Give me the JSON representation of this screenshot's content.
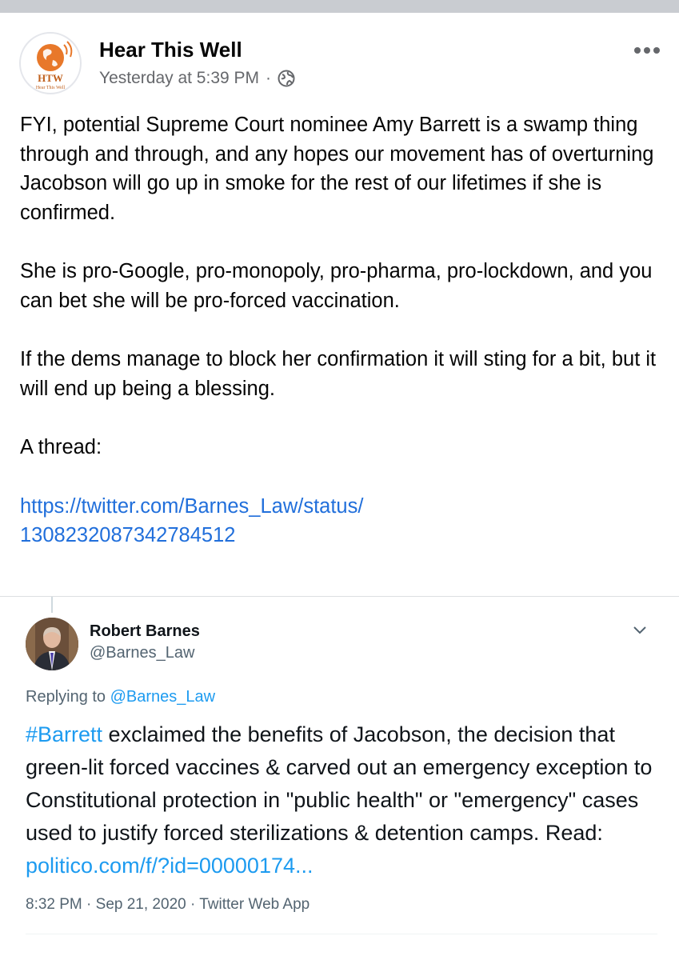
{
  "post": {
    "author": "Hear This Well",
    "timestamp": "Yesterday at 5:39 PM",
    "separator": "·",
    "privacy_icon": "globe-icon",
    "avatar_logo_text": "HTW",
    "avatar_logo_subtext": "Hear This Well",
    "paragraphs": [
      "FYI, potential Supreme Court nominee Amy Barrett is a swamp thing through and through, and any hopes our movement has of overturning Jacobson will go up in smoke for the rest of our lifetimes if she is confirmed.",
      "She is pro-Google, pro-monopoly, pro-pharma, pro-lockdown, and you can bet she will be pro-forced vaccination.",
      "If the dems manage to block her confirmation it will sting for a bit, but it will end up being a blessing.",
      "A thread:"
    ],
    "link_line1": "https://twitter.com/Barnes_Law/status/",
    "link_line2": "1308232087342784512"
  },
  "tweet": {
    "name": "Robert Barnes",
    "handle": "@Barnes_Law",
    "replying_prefix": "Replying to",
    "replying_to": "@Barnes_Law",
    "hashtag": "#Barrett",
    "text": " exclaimed the benefits of Jacobson, the decision that green-lit forced vaccines & carved out an emergency exception to Constitutional protection in \"public health\" or \"emergency\" cases used to justify forced sterilizations & detention camps. Read: ",
    "url": "politico.com/f/?id=00000174...",
    "time": "8:32 PM",
    "date": "Sep 21, 2020",
    "source": "Twitter Web App",
    "meta_separator": "·"
  },
  "colors": {
    "link": "#216fdb",
    "twitter_blue": "#1d9bf0",
    "brand_orange": "#e8782a"
  }
}
